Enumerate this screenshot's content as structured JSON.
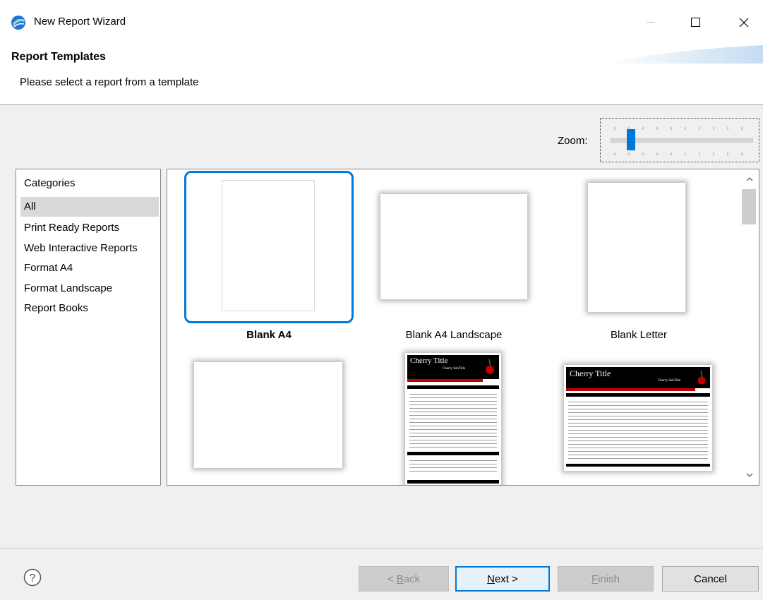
{
  "window": {
    "title": "New Report Wizard",
    "icon": "eclipse-birt-icon",
    "controls": {
      "minimize": "—",
      "maximize": "☐",
      "close": "✕"
    }
  },
  "header": {
    "title": "Report Templates",
    "description": "Please select a report from a template"
  },
  "zoom": {
    "label": "Zoom:",
    "level": 0.12
  },
  "categories": {
    "heading": "Categories",
    "items": [
      "All",
      "Print Ready Reports",
      "Web Interactive Reports",
      "Format A4",
      "Format Landscape",
      "Report Books"
    ],
    "selected": "All"
  },
  "templates": [
    {
      "label": "Blank A4",
      "selected": true
    },
    {
      "label": "Blank A4 Landscape",
      "selected": false
    },
    {
      "label": "Blank Letter",
      "selected": false
    }
  ],
  "thumbnails": {
    "cherry_title": "Cherry Title",
    "cherry_subtitle": "Cherry SubTitle"
  },
  "buttons": {
    "back_pre": "< ",
    "back_mnemonic": "B",
    "back_rest": "ack",
    "next_mnemonic": "N",
    "next_rest": "ext >",
    "finish_mnemonic": "F",
    "finish_rest": "inish",
    "cancel": "Cancel"
  },
  "colors": {
    "accent": "#0078d7",
    "cherry_red": "#c00000"
  }
}
